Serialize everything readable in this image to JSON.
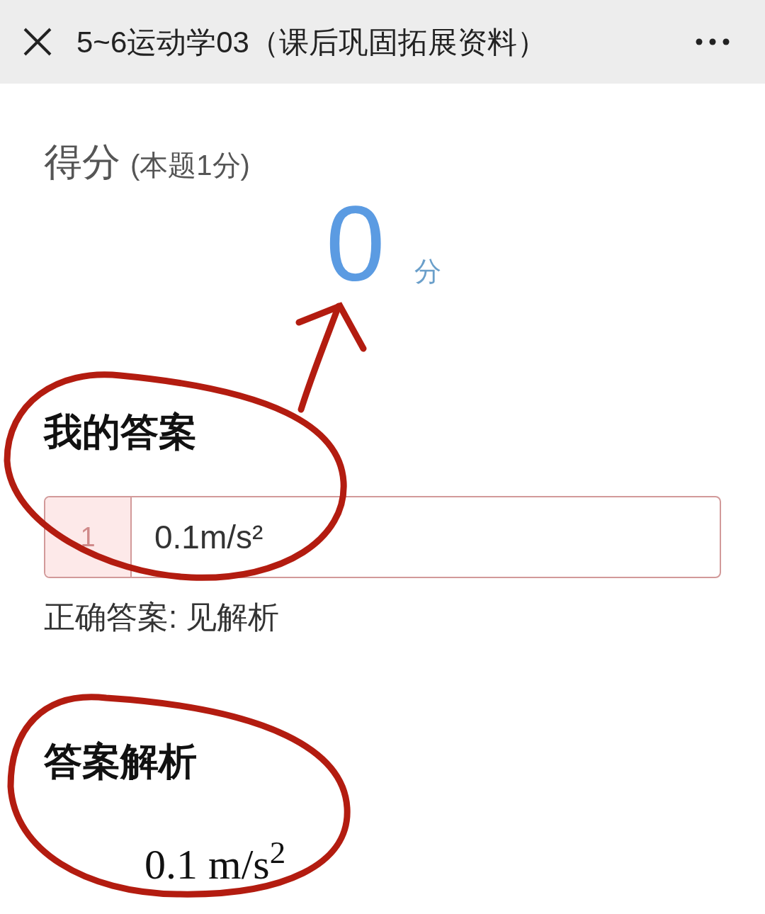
{
  "header": {
    "title": "5~6运动学03（课后巩固拓展资料）"
  },
  "score": {
    "label": "得分",
    "note": "(本题1分)",
    "value": "0",
    "unit": "分"
  },
  "my_answer": {
    "heading": "我的答案",
    "blanks": [
      {
        "index": "1",
        "value": "0.1m/s²",
        "correct": false
      }
    ],
    "correct_answer": "正确答案: 见解析"
  },
  "analysis": {
    "heading": "答案解析",
    "text": "0.1 m/s$^{2}$"
  }
}
